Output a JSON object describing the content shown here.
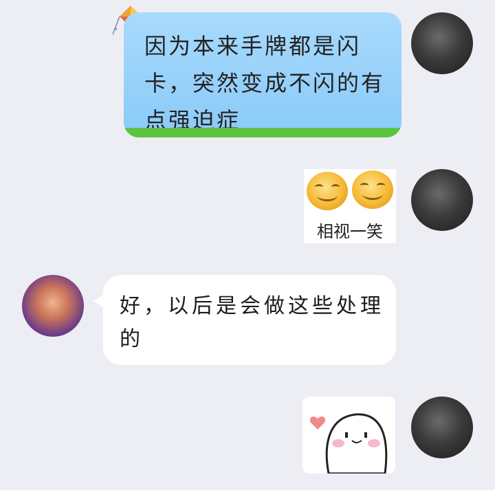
{
  "messages": [
    {
      "sender": "self",
      "type": "text",
      "style": "kite-bubble",
      "text": "因为本来手牌都是闪卡，突然变成不闪的有点强迫症"
    },
    {
      "sender": "self",
      "type": "sticker",
      "sticker": "two-smiley-faces",
      "caption": "相视一笑"
    },
    {
      "sender": "other",
      "type": "text",
      "text": "好，以后是会做这些处理的"
    },
    {
      "sender": "self",
      "type": "sticker",
      "sticker": "blushing-white-blob-heart"
    }
  ],
  "colors": {
    "background": "#eceef4",
    "bubble_blue": "#8fcdfa",
    "bubble_grass": "#5cc341",
    "bubble_white": "#ffffff"
  }
}
